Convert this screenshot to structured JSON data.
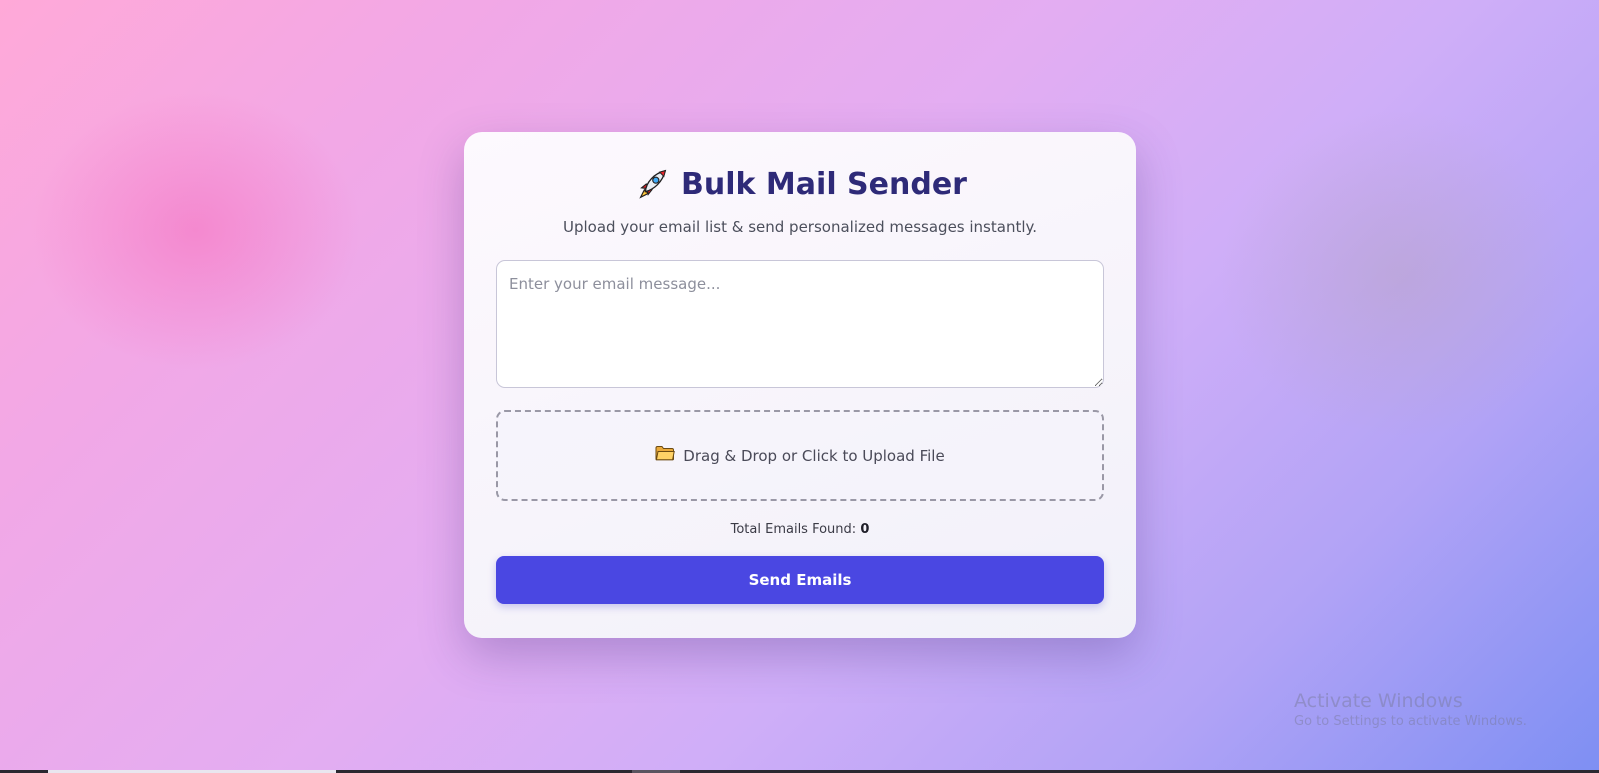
{
  "header": {
    "title": "Bulk Mail Sender",
    "subtitle": "Upload your email list & send personalized messages instantly.",
    "icon": "rocket-icon"
  },
  "message": {
    "placeholder": "Enter your email message...",
    "value": ""
  },
  "upload": {
    "icon": "folder-icon",
    "label": "Drag & Drop or Click to Upload File"
  },
  "stats": {
    "label": "Total Emails Found:",
    "count": "0"
  },
  "actions": {
    "send_label": "Send Emails"
  },
  "watermark": {
    "title": "Activate Windows",
    "subtitle": "Go to Settings to activate Windows."
  },
  "colors": {
    "accent": "#4a47e2",
    "title": "#2e2a78",
    "background_start": "#ffa9d8",
    "background_end": "#7e8ff3"
  }
}
